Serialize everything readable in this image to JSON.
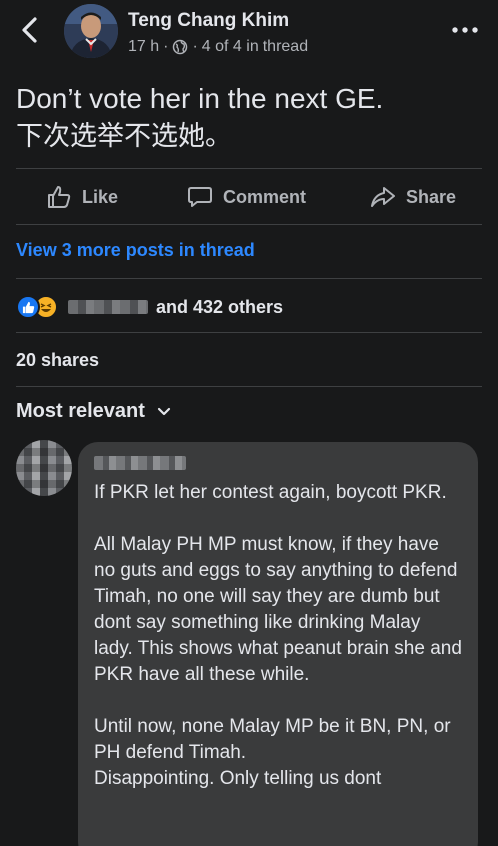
{
  "post": {
    "author": "Teng Chang Khim",
    "time": "17 h",
    "separator": "·",
    "thread_position": "4 of 4 in",
    "thread_word": "thread",
    "text_line1": "Don’t vote her in the next GE.",
    "text_line2": "下次选举不选她。"
  },
  "actions": {
    "like": "Like",
    "comment": "Comment",
    "share": "Share"
  },
  "thread_link": "View 3 more posts in thread",
  "reactions": {
    "others": "and 432 others",
    "types": [
      "like",
      "haha"
    ]
  },
  "shares": "20 shares",
  "sort": {
    "label": "Most relevant"
  },
  "comment": {
    "text": "If PKR let her contest again, boycott PKR.\n\nAll Malay PH MP must know, if they have no guts and eggs to say anything to defend Timah, no one will say they are dumb but dont say something like drinking Malay lady. This shows what peanut brain she and PKR have all these while.\n\nUntil now, none Malay MP be it BN, PN, or PH defend Timah.\nDisappointing. Only telling us dont"
  },
  "colors": {
    "background": "#18191a",
    "link": "#2d88ff",
    "bubble": "#3a3b3c",
    "like_reaction": "#1877f2",
    "haha_reaction": "#f7b125"
  },
  "icons": [
    "back-chevron-icon",
    "globe-icon",
    "more-dots-icon",
    "thumbs-up-icon",
    "comment-bubble-icon",
    "share-arrow-icon",
    "chevron-down-icon"
  ]
}
